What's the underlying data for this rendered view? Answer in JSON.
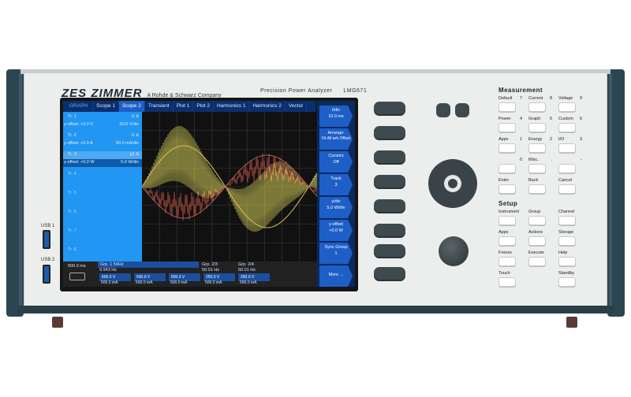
{
  "brand": {
    "logo": "ZES ZIMMER",
    "subtitle": "A Rohde & Schwarz Company"
  },
  "product": {
    "name": "Precision Power Analyzer",
    "model": "LMG671"
  },
  "usb": [
    "USB 1",
    "USB 2"
  ],
  "screen": {
    "tabs": [
      "GRAPH",
      "Scope 1",
      "Scope 2",
      "Transient",
      "Plot 1",
      "Plot 2",
      "Harmonics 1",
      "Harmonics 2",
      "Vector"
    ],
    "active_tab": "Scope 2",
    "channels": [
      {
        "name": "Tr. 1",
        "right": "i1 Δ",
        "sub": "y-offset: +0.0 V",
        "sub_right": "50.0 V/div"
      },
      {
        "name": "Tr. 2",
        "right": "i1 Δ",
        "sub": "y-offset: +0.0 A",
        "sub_right": "50.0 mA/div"
      },
      {
        "name": "Tr. 3",
        "right": "p1 Δ",
        "sub": "y-offset: +0.0 W",
        "sub_right": "5.0 W/div"
      },
      {
        "name": "Tr. 4"
      },
      {
        "name": "Tr. 5"
      },
      {
        "name": "Tr. 6"
      },
      {
        "name": "Tr. 7"
      },
      {
        "name": "Tr. 8"
      }
    ],
    "softkeys": [
      {
        "label": "t/div",
        "value": "10.0 ms"
      },
      {
        "label": "Arrange:",
        "value": "Fit All w/o Offset"
      },
      {
        "label": "Cursors",
        "value": "Off"
      },
      {
        "label": "Track",
        "value": "3"
      },
      {
        "label": "y/div",
        "value": "5.0 W/div"
      },
      {
        "label": "y-offset",
        "value": "+0.0 W"
      },
      {
        "label": "Sync Group",
        "value": "1"
      },
      {
        "label": "More ...",
        "value": ""
      }
    ],
    "status": {
      "time": "500.0 ms",
      "grp1": "Grp. 1 50Hz",
      "grp1_freq": "9.943 Hz",
      "grp2": "Grp. 2/3",
      "grp2_freq": "50.01 Hz",
      "grp3": "Grp. 2/4",
      "grp3_freq": "50.01 Hz",
      "blocks": [
        "600.0 V",
        "600.0 V",
        "600.0 V",
        "250.0 V",
        "250.0 V"
      ],
      "blocks2": [
        "500.0 mA",
        "500.0 mA",
        "500.0 mA",
        "500.0 mA",
        "500.0 mA"
      ]
    },
    "plot": {
      "description_series": [
        "voltage",
        "current",
        "power"
      ],
      "colors": {
        "voltage": "#d8c05a",
        "current": "#cf5a48",
        "power": "#e8e060",
        "grid": "#3c3c3c"
      }
    }
  },
  "measurement": {
    "title": "Measurement",
    "keys": [
      {
        "label": "Default",
        "num": "7"
      },
      {
        "label": "Current",
        "num": "8"
      },
      {
        "label": "Voltage",
        "num": "9"
      },
      {
        "label": "Power",
        "num": "4"
      },
      {
        "label": "Graph",
        "num": "5"
      },
      {
        "label": "Custom",
        "num": "6"
      },
      {
        "label": "Apps",
        "num": "1"
      },
      {
        "label": "Energy",
        "num": "2"
      },
      {
        "label": "I/O",
        "num": "3"
      },
      {
        "label": "",
        "num": "0"
      },
      {
        "label": "Misc.",
        "num": "."
      },
      {
        "label": "",
        "num": "-"
      },
      {
        "label": "Enter",
        "num": ""
      },
      {
        "label": "Back",
        "num": ""
      },
      {
        "label": "Cancel",
        "num": ""
      }
    ]
  },
  "setup": {
    "title": "Setup",
    "keys": [
      {
        "label": "Instrument"
      },
      {
        "label": "Group"
      },
      {
        "label": "Channel"
      },
      {
        "label": "Apps"
      },
      {
        "label": "Actions"
      },
      {
        "label": "Storage"
      },
      {
        "label": "Freeze"
      },
      {
        "label": "Execute"
      },
      {
        "label": "Help"
      },
      {
        "label": "Touch"
      },
      {
        "label": ""
      },
      {
        "label": "Standby"
      }
    ]
  }
}
